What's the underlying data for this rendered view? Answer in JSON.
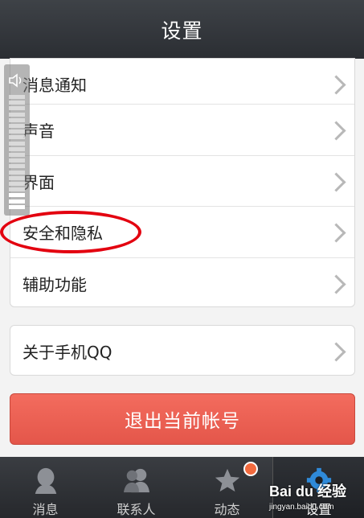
{
  "header": {
    "title": "设置"
  },
  "settings_group": {
    "items": [
      {
        "label": "消息通知"
      },
      {
        "label": "声音"
      },
      {
        "label": "界面"
      },
      {
        "label": "安全和隐私"
      },
      {
        "label": "辅助功能"
      }
    ]
  },
  "about_group": {
    "label": "关于手机QQ"
  },
  "logout_button": {
    "label": "退出当前帐号"
  },
  "volume_overlay": {
    "icon": "speaker-icon",
    "level": 0.15
  },
  "annotation": {
    "color": "#e3000f",
    "target": "安全和隐私"
  },
  "tabbar": {
    "tabs": [
      {
        "label": "消息",
        "icon": "chat-person-icon"
      },
      {
        "label": "联系人",
        "icon": "contacts-icon"
      },
      {
        "label": "动态",
        "icon": "star-feed-icon",
        "badge": "dot"
      },
      {
        "label": "设置",
        "icon": "gear-icon",
        "active": true
      }
    ]
  },
  "watermark": {
    "text": "Bai du 经验",
    "url": "jingyan.baidu.com"
  },
  "colors": {
    "accent": "#e4564a",
    "header_bg": "#2b2e33",
    "badge": "#f26a3e"
  }
}
